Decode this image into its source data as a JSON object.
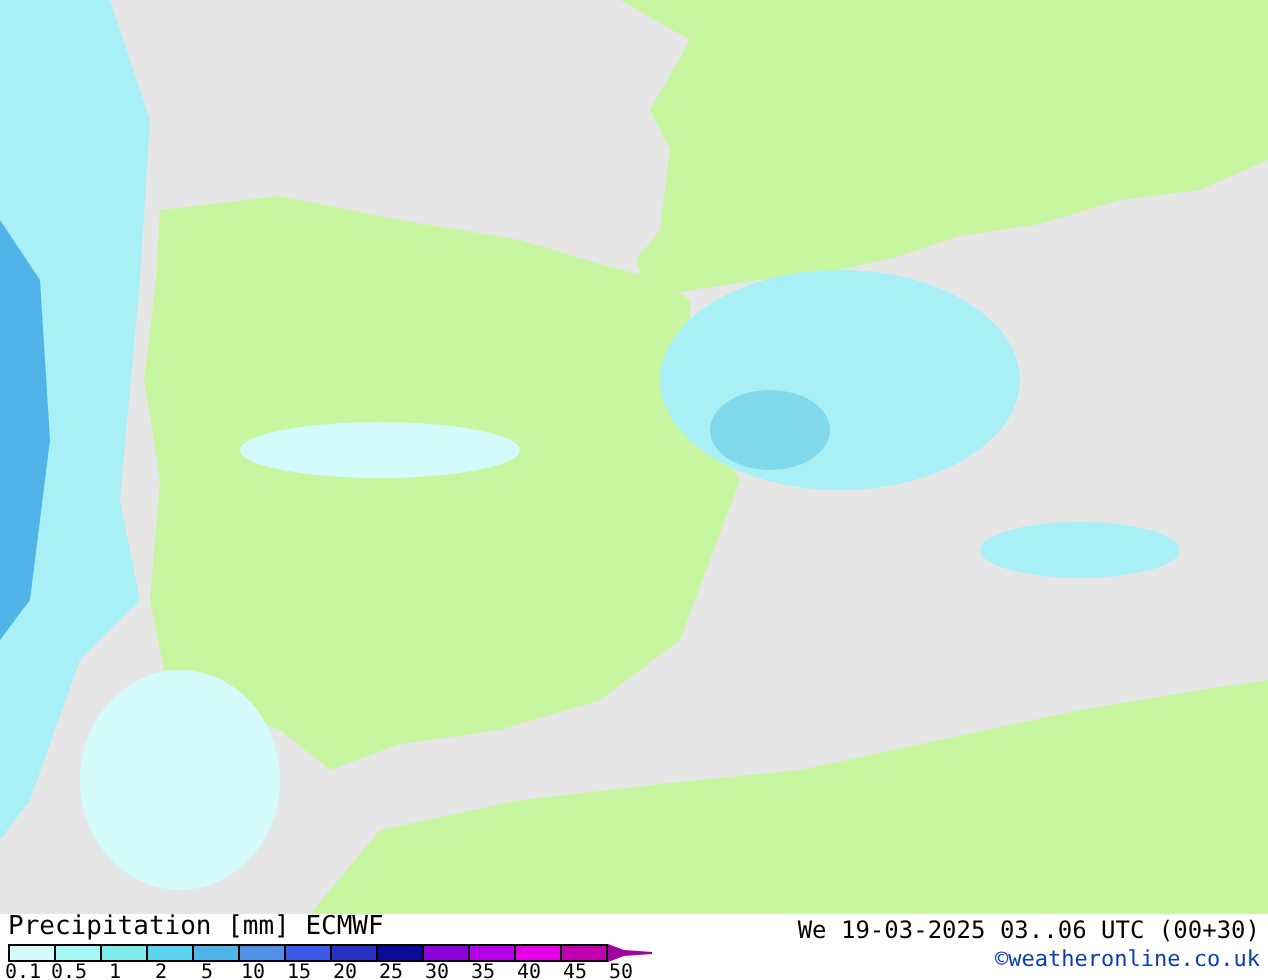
{
  "title": "Precipitation [mm]  ECMWF",
  "valid_time": "We 19-03-2025 03..06 UTC (00+30)",
  "credit": "©weatheronline.co.uk",
  "legend": {
    "steps": [
      {
        "color": "#d4fbfb"
      },
      {
        "color": "#a8f8f8"
      },
      {
        "color": "#80ebeb"
      },
      {
        "color": "#5cd4f0"
      },
      {
        "color": "#50b4e8"
      },
      {
        "color": "#5090e6"
      },
      {
        "color": "#3c5ae6"
      },
      {
        "color": "#2832c0"
      },
      {
        "color": "#0a0a96"
      },
      {
        "color": "#8c00dc"
      },
      {
        "color": "#b400e6"
      },
      {
        "color": "#e600e6"
      },
      {
        "color": "#c000b0"
      },
      {
        "color": "#a000a0",
        "kind": "arrow"
      }
    ],
    "labels": [
      "0.1",
      "0.5",
      "1",
      "2",
      "5",
      "10",
      "15",
      "20",
      "25",
      "30",
      "35",
      "40",
      "45",
      "50"
    ]
  }
}
